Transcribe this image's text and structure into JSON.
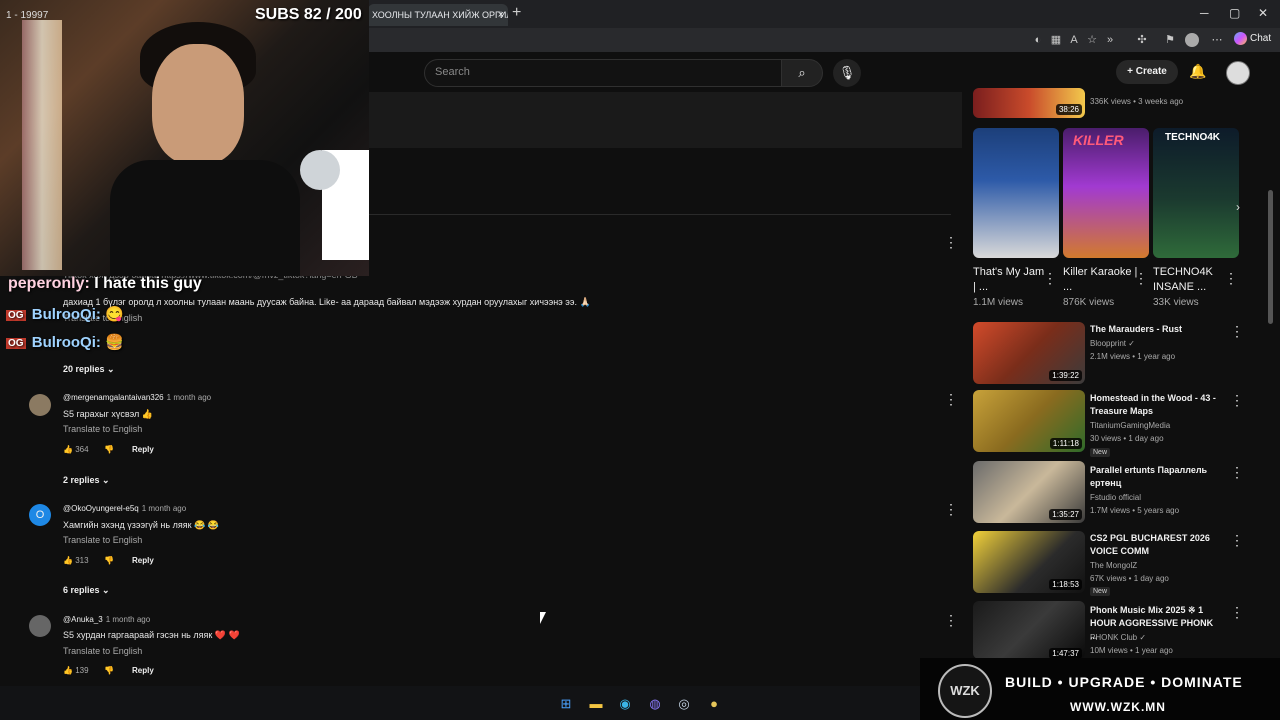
{
  "browser": {
    "tab_title": "ХООЛНЫ ТУЛААН ХИЙЖ ОРГИЛ",
    "tab_close": "×",
    "new_tab": "+",
    "chat_label": "Chat",
    "win_min": "─",
    "win_max": "▢",
    "win_close": "✕"
  },
  "youtube": {
    "search_placeholder": "Search",
    "create_label": "Create"
  },
  "overlay": {
    "subs": "SUBS 82 / 200",
    "stream_id": "1 - 19997",
    "chat": [
      {
        "user": "peperonly:",
        "text": "I hate this guy"
      },
      {
        "badge": "OG",
        "user": "BulrooQi:",
        "emoji": "😋"
      },
      {
        "badge": "OG",
        "user": "BulrooQi:",
        "emoji": "🍔"
      }
    ]
  },
  "comments": {
    "partial_link_line": "Tiktok хаяг дээр байна. https://www.tiktok.com/@mvz_tiktok?lang=en-GB",
    "top_comment_text": "дахиад 1 бүлэг оролд л хоолны тулаан маань дуусаж байна. Like- аа дараад байвал мэдээж хурдан оруулахыг хичээнэ ээ. 🙏🏻",
    "top_translate": "Translate to English",
    "top_replies": "20 replies",
    "items": [
      {
        "handle": "@mergenamgalantaivan326",
        "ago": "1 month ago",
        "text": "S5 гарахыг хүсвэл 👍",
        "translate": "Translate to English",
        "likes": "364",
        "reply": "Reply",
        "replies": "2 replies",
        "avatar_letter": ""
      },
      {
        "handle": "@OkoOyungerel-e5q",
        "ago": "1 month ago",
        "text": "Хамгийн эхэнд үзээгүй нь ляяк 😂 😂",
        "translate": "Translate to English",
        "likes": "313",
        "reply": "Reply",
        "replies": "6 replies",
        "avatar_letter": "O"
      },
      {
        "handle": "@Anuka_3",
        "ago": "1 month ago",
        "text": "S5 хурдан гаргаараай гэсэн нь ляяк ❤️ ❤️",
        "translate": "Translate to English",
        "likes": "139",
        "reply": "Reply",
        "replies": "",
        "avatar_letter": ""
      }
    ]
  },
  "sidebar": {
    "top_partial": {
      "views": "336K views",
      "ago": "3 weeks ago",
      "duration": "38:26"
    },
    "shorts": [
      {
        "title": "That's My Jam | ...",
        "views": "1.1M views",
        "thumb_text": ""
      },
      {
        "title": "Killer Karaoke | ...",
        "views": "876K views",
        "thumb_text": "KILLER"
      },
      {
        "title": "TECHNO4K INSANE ...",
        "views": "33K views",
        "thumb_text": "TECHNO4K"
      }
    ],
    "videos": [
      {
        "title": "The Marauders - Rust",
        "channel": "Bloopprint ✓",
        "meta": "2.1M views • 1 year ago",
        "duration": "1:39:22",
        "new": ""
      },
      {
        "title": "Homestead in the Wood - 43 - Treasure Maps",
        "channel": "TitaniumGamingMedia",
        "meta": "30 views • 1 day ago",
        "duration": "1:11:18",
        "new": "New"
      },
      {
        "title": "Parallel ertunts Параллель ертөнц",
        "channel": "Fstudio official",
        "meta": "1.7M views • 5 years ago",
        "duration": "1:35:27",
        "new": ""
      },
      {
        "title": "CS2 PGL BUCHAREST 2026 VOICE COMM",
        "channel": "The MongolZ",
        "meta": "67K views • 1 day ago",
        "duration": "1:18:53",
        "new": "New"
      },
      {
        "title": "Phonk Music Mix 2025 ※ 1 HOUR AGGRESSIVE PHONK ...",
        "channel": "PHONK Club ✓",
        "meta": "10M views • 1 year ago",
        "duration": "1:47:37",
        "new": ""
      }
    ]
  },
  "banner": {
    "logo": "WZK",
    "line1": "BUILD • UPGRADE • DOMINATE",
    "line2": "WWW.WZK.MN"
  },
  "colors": {
    "background": "#0f0f0f",
    "og_badge": "#c0392b",
    "chat_name": "#9fd3ff"
  }
}
